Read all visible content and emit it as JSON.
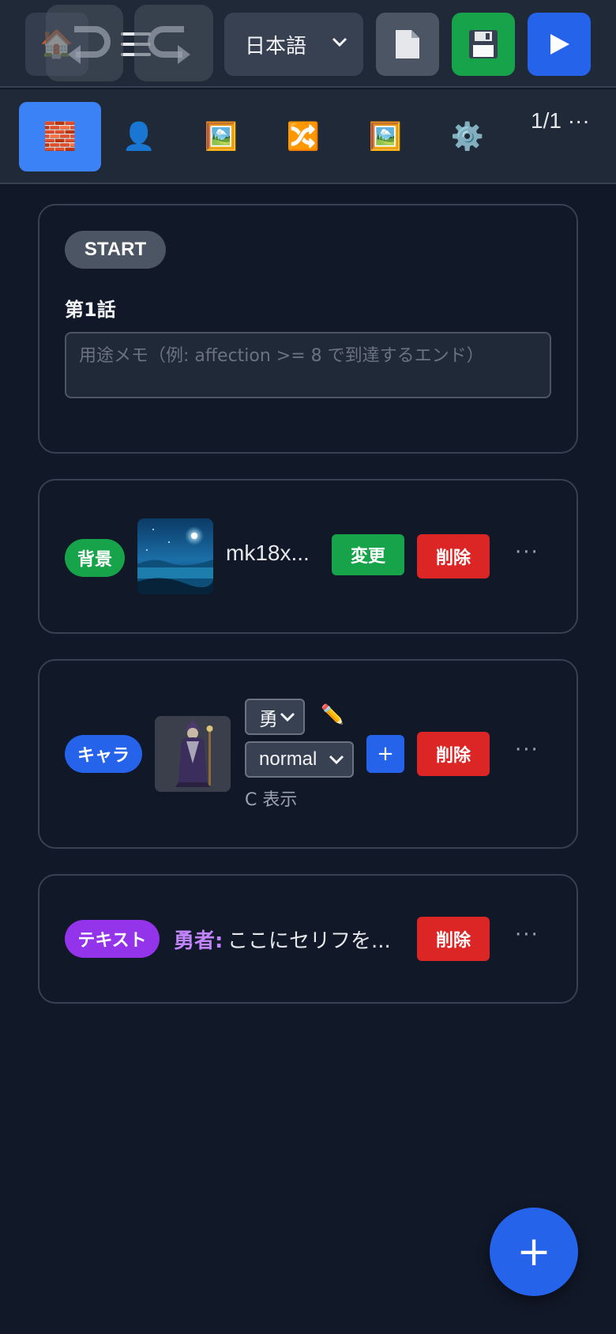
{
  "toolbar": {
    "home_icon": "house-icon",
    "menu_icon": "hamburger-icon",
    "undo_icon": "undo-arrow-icon",
    "redo_icon": "redo-arrow-icon",
    "language": "日本語",
    "doc_icon": "document-icon",
    "save_icon": "floppy-disk-icon",
    "play_icon": "play-icon",
    "colors": {
      "save": "#16a34a",
      "play": "#2563eb"
    }
  },
  "tabs": {
    "items": [
      {
        "icon": "bricks-icon",
        "active": true
      },
      {
        "icon": "person-icon",
        "active": false
      },
      {
        "icon": "picture-icon",
        "active": false
      },
      {
        "icon": "shuffle-icon",
        "active": false
      },
      {
        "icon": "picture-icon",
        "active": false
      },
      {
        "icon": "gear-icon",
        "active": false
      }
    ],
    "page": "1/1",
    "more": "···"
  },
  "blocks": {
    "start": {
      "badge": "START",
      "title": "第1話",
      "memo_placeholder": "用途メモ（例: affection >= 8 で到達するエンド）"
    },
    "background": {
      "badge": "背景",
      "file_name": "mk18x...",
      "change_label": "変更",
      "delete_label": "削除",
      "more": "···"
    },
    "character": {
      "badge": "キャラ",
      "name_value": "勇",
      "expression_value": "normal",
      "add_label": "+",
      "delete_label": "削除",
      "position_label": "C 表示",
      "more": "···"
    },
    "text": {
      "badge": "テキスト",
      "speaker": "勇者:",
      "dialogue": "ここにセリフを...",
      "delete_label": "削除",
      "more": "···"
    }
  },
  "fab": {
    "label": "+"
  }
}
